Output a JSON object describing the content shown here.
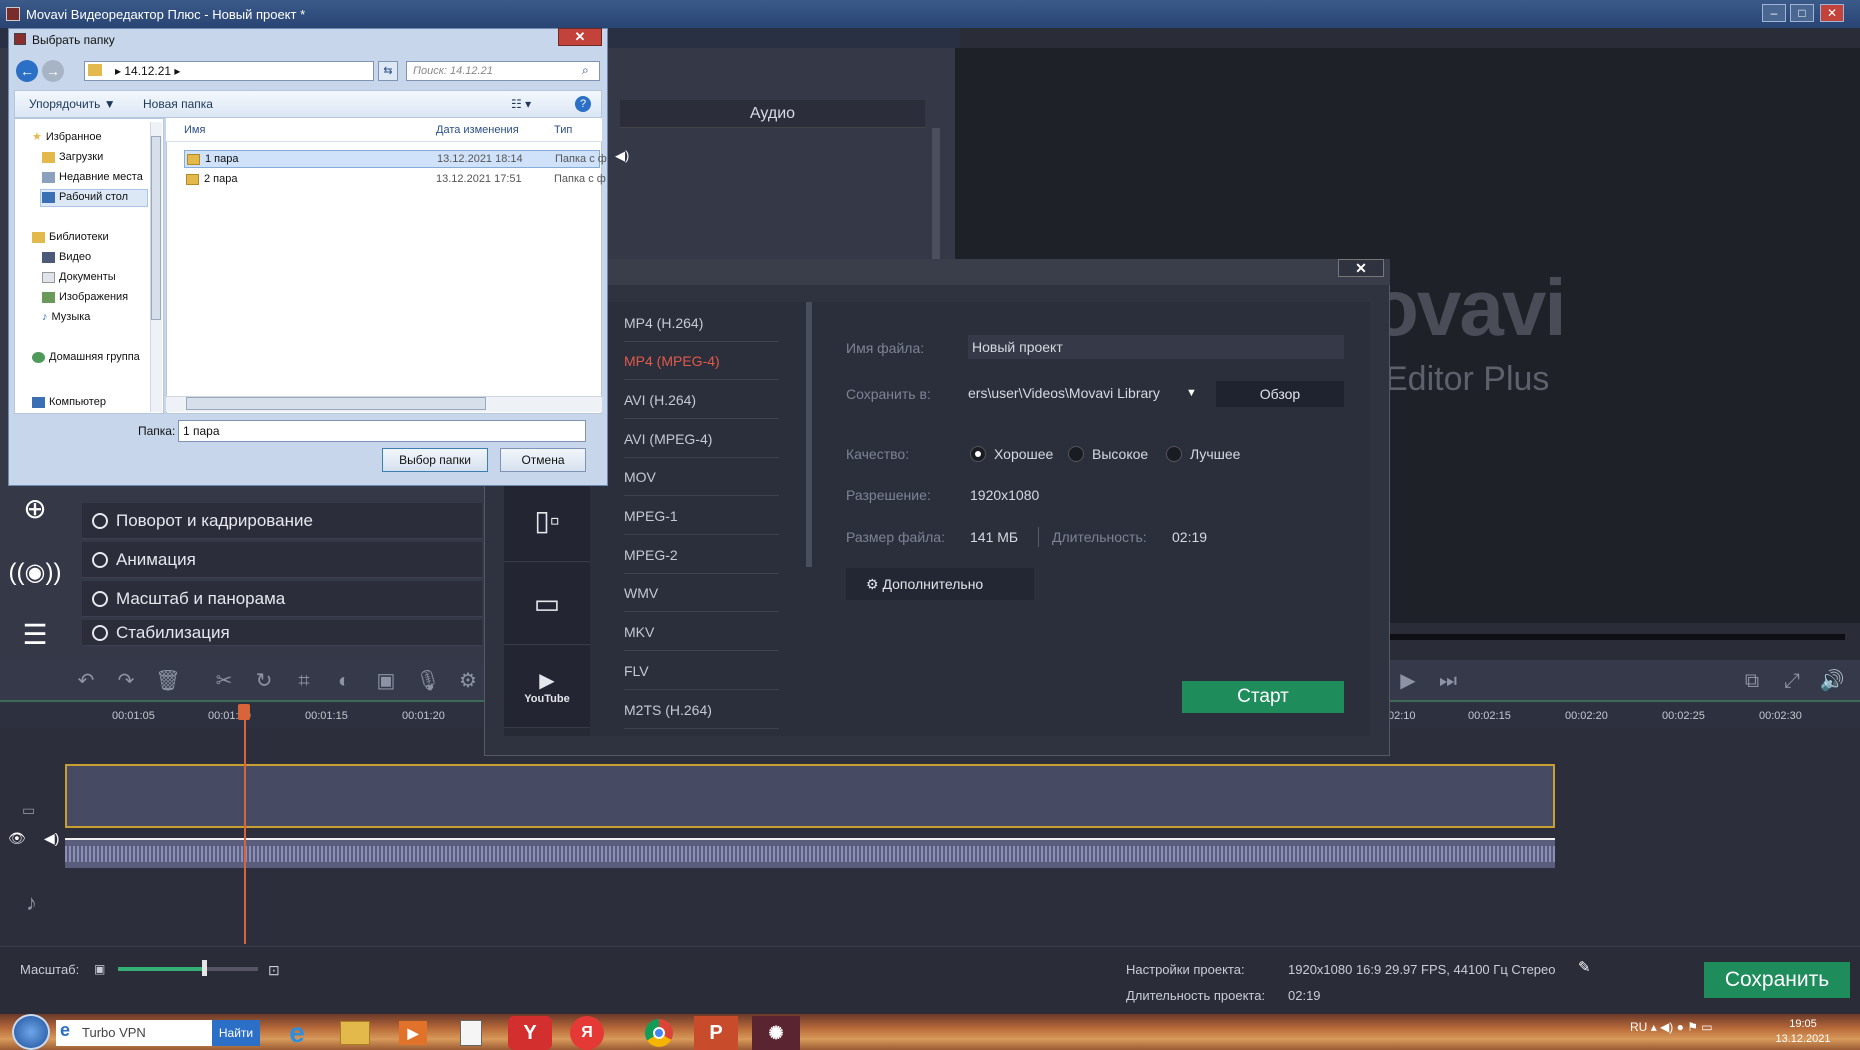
{
  "app": {
    "window_title": "Movavi Видеоредактор Плюс - Новый проект *",
    "window_controls": [
      "–",
      "□",
      "✕"
    ]
  },
  "audio_panel": {
    "header": "Аудио"
  },
  "preview": {
    "logo": "ovavi",
    "subtitle": "Editor Plus"
  },
  "filters": {
    "items": [
      "Поворот и кадрирование",
      "Анимация",
      "Масштаб и панорама",
      "Стабилизация"
    ]
  },
  "timeline": {
    "ruler_ticks": [
      "00:01:05",
      "00:01:10",
      "00:01:15",
      "00:01:20",
      "02:10",
      "00:02:15",
      "00:02:20",
      "00:02:25",
      "00:02:30"
    ]
  },
  "bottom": {
    "zoom_label": "Масштаб:",
    "zoom_level": 0.6,
    "project_settings_label": "Настройки проекта:",
    "project_settings_value": "1920x1080 16:9 29.97 FPS, 44100 Гц Стерео",
    "project_duration_label": "Длительность проекта:",
    "project_duration_value": "02:19",
    "save_button": "Сохранить"
  },
  "export_dialog": {
    "close": "✕",
    "categories": [
      "devices-icon",
      "tablet-icon",
      "youtube-icon"
    ],
    "youtube_label": "YouTube",
    "formats": [
      "MP4 (H.264)",
      "MP4 (MPEG-4)",
      "AVI (H.264)",
      "AVI (MPEG-4)",
      "MOV",
      "MPEG-1",
      "MPEG-2",
      "WMV",
      "MKV",
      "FLV",
      "M2TS (H.264)"
    ],
    "selected_format": "MP4 (MPEG-4)",
    "file_name_label": "Имя файла:",
    "file_name_value": "Новый проект",
    "save_to_label": "Сохранить в:",
    "save_to_value": "ers\\user\\Videos\\Movavi Library",
    "browse_button": "Обзор",
    "quality_label": "Качество:",
    "quality_options": [
      "Хорошее",
      "Высокое",
      "Лучшее"
    ],
    "quality_selected": "Хорошее",
    "resolution_label": "Разрешение:",
    "resolution_value": "1920x1080",
    "file_size_label": "Размер файла:",
    "file_size_value": "141 МБ",
    "duration_label": "Длительность:",
    "duration_value": "02:19",
    "advanced_button": "Дополнительно",
    "start_button": "Старт",
    "colors": {
      "start": "#1e8d5b",
      "selected_format": "#e05a4a"
    }
  },
  "folder_dialog": {
    "title": "Выбрать папку",
    "address_path": "14.12.21",
    "search_placeholder": "Поиск: 14.12.21",
    "toolbar_organize": "Упорядочить ▼",
    "toolbar_new_folder": "Новая папка",
    "nav": {
      "favorites": "Избранное",
      "downloads": "Загрузки",
      "recent": "Недавние места",
      "desktop": "Рабочий стол",
      "libraries": "Библиотеки",
      "video": "Видео",
      "documents": "Документы",
      "images": "Изображения",
      "music": "Музыка",
      "homegroup": "Домашняя группа",
      "computer": "Компьютер"
    },
    "columns": {
      "name": "Имя",
      "date": "Дата изменения",
      "type": "Тип"
    },
    "rows": [
      {
        "name": "1 пара",
        "date": "13.12.2021 18:14",
        "type": "Папка с ф"
      },
      {
        "name": "2 пара",
        "date": "13.12.2021 17:51",
        "type": "Папка с ф"
      }
    ],
    "folder_label": "Папка:",
    "folder_value": "1 пара",
    "select_button": "Выбор папки",
    "cancel_button": "Отмена",
    "close": "✕"
  },
  "taskbar": {
    "search_value": "Turbo VPN",
    "search_button": "Найти",
    "apps": [
      "ie-icon",
      "explorer-icon",
      "media-icon",
      "notepad-icon",
      "yandex-browser-icon",
      "yandex-icon",
      "chrome-icon",
      "powerpoint-icon",
      "movavi-icon"
    ],
    "tray_lang": "RU",
    "time": "19:05",
    "date": "13.12.2021"
  }
}
